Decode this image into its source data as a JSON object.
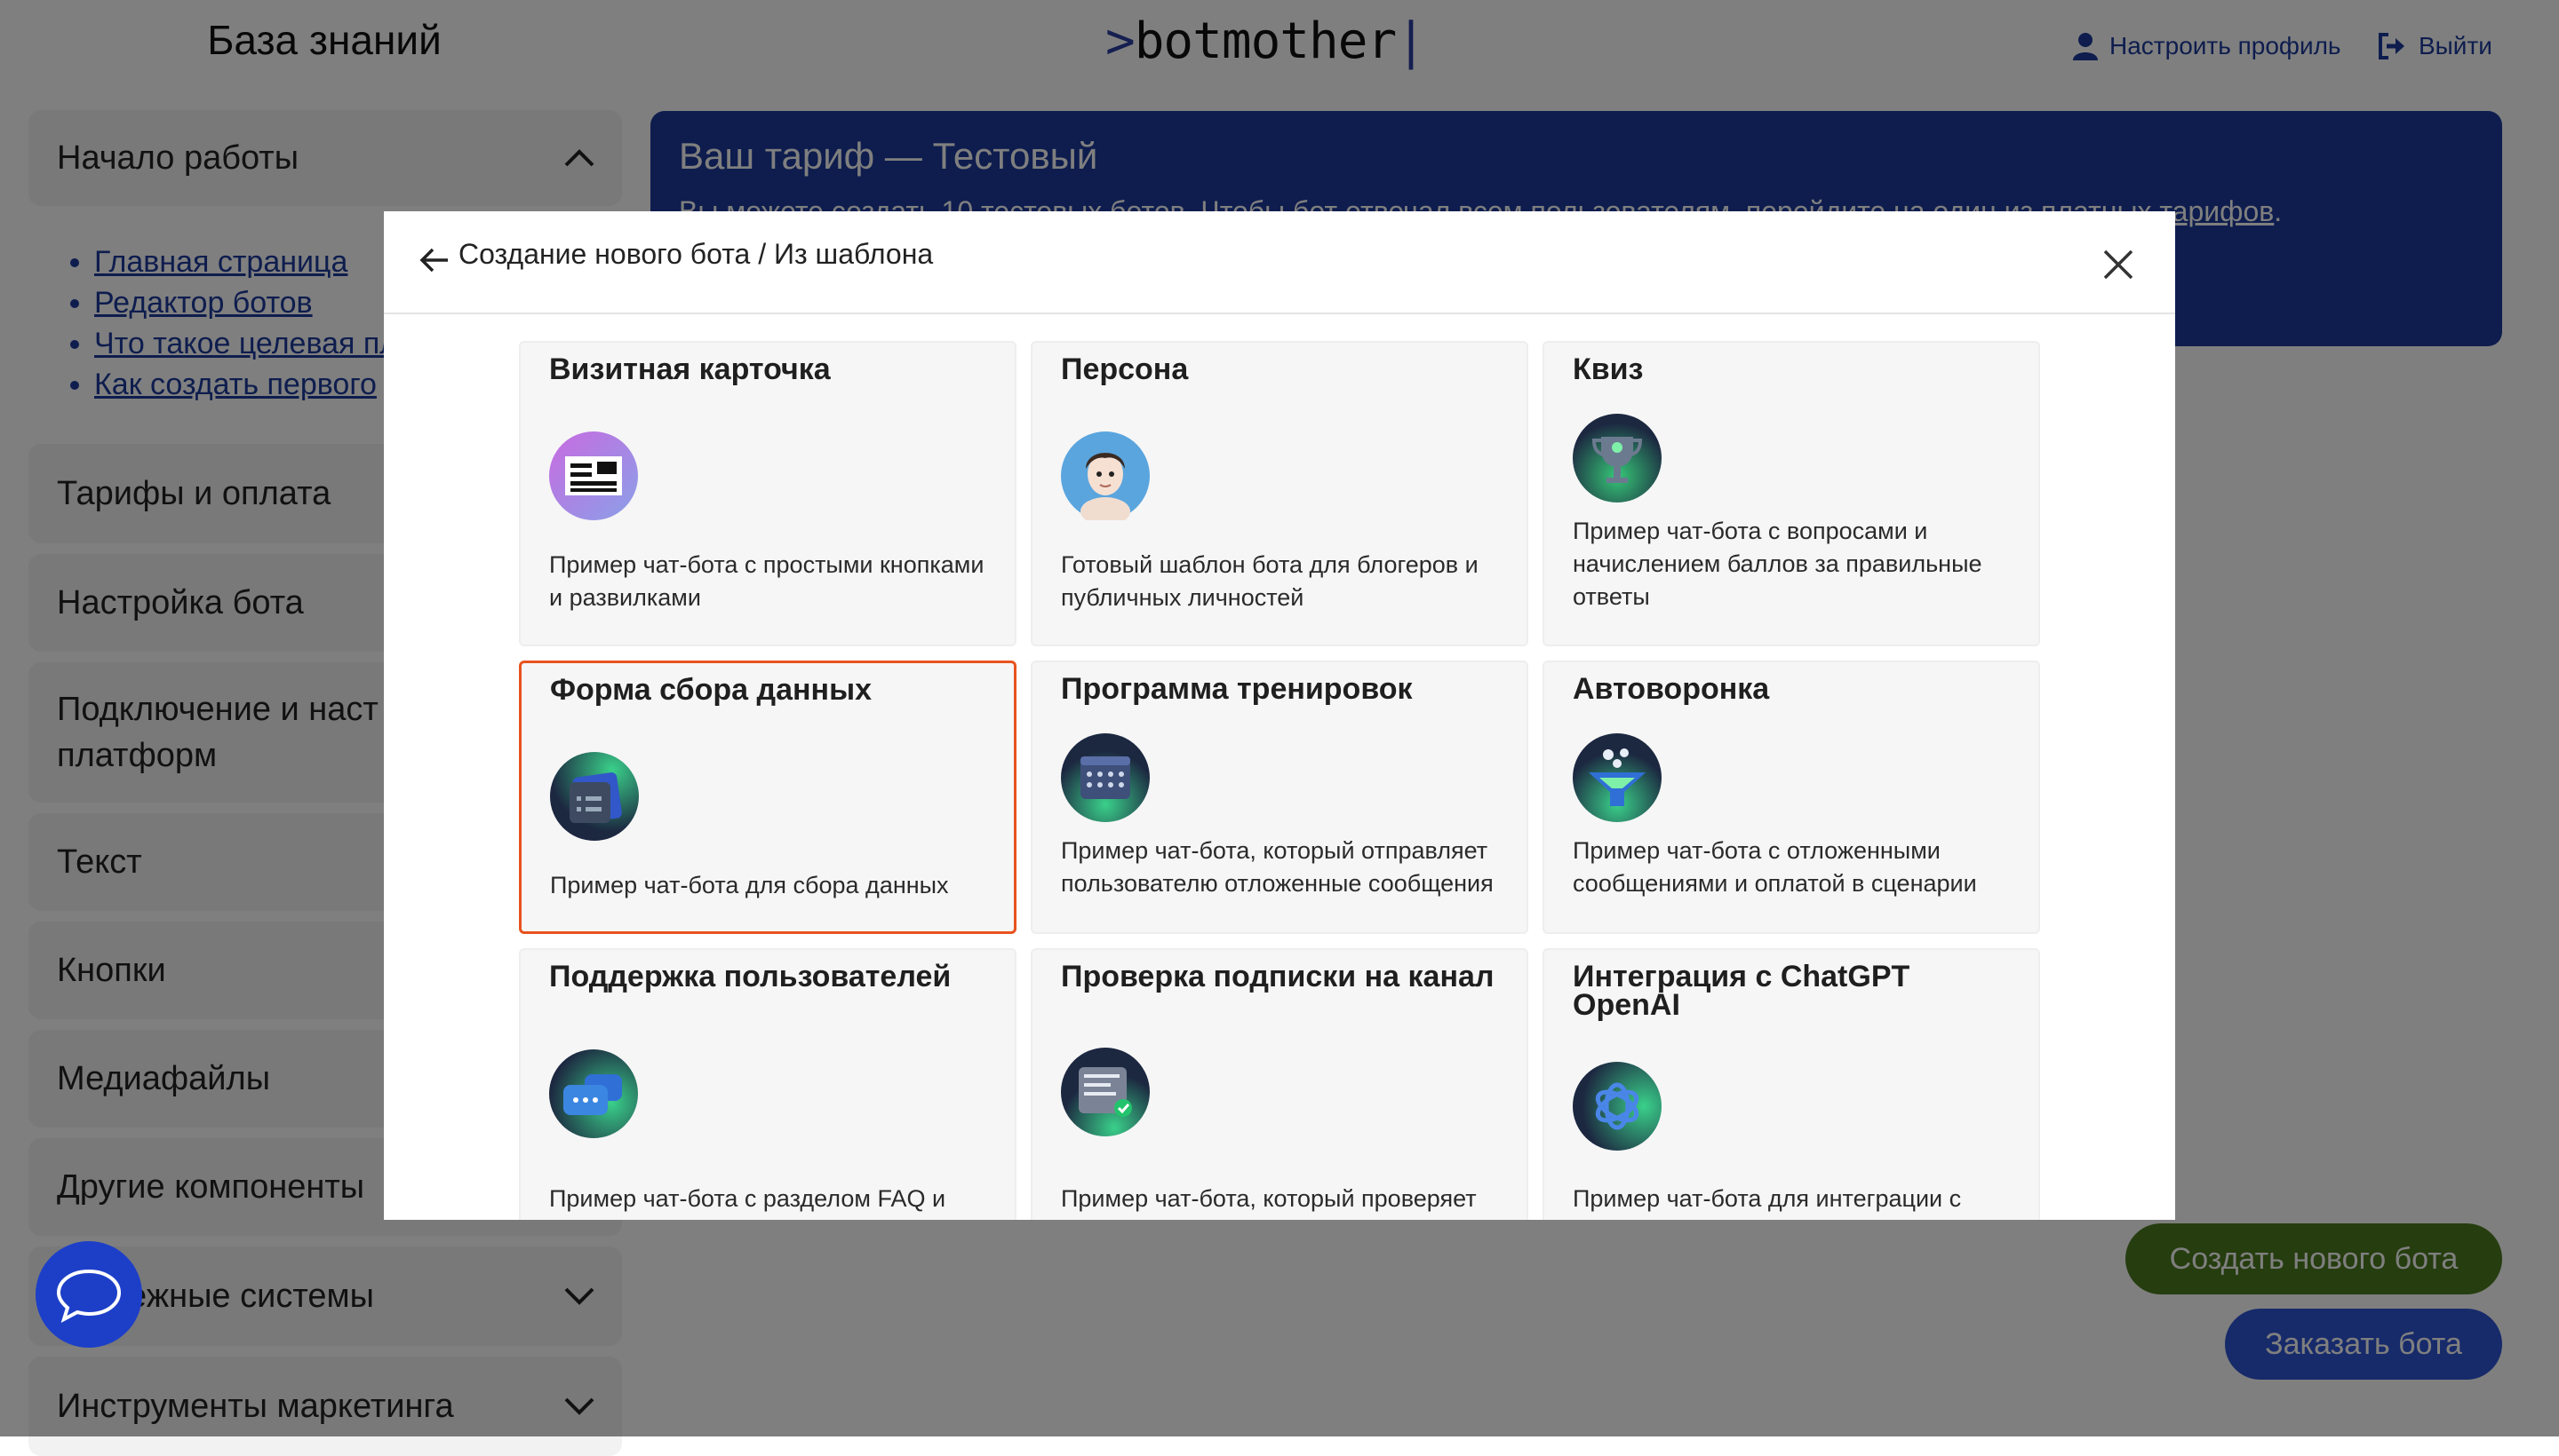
{
  "header": {
    "kb_title": "База знаний",
    "logo_gt": ">",
    "logo_text": "botmother",
    "logo_cursor": "|",
    "profile_label": "Настроить профиль",
    "logout_label": "Выйти"
  },
  "sidebar": {
    "sections": [
      {
        "label": "Начало работы",
        "expanded": true
      },
      {
        "label": "Тарифы и оплата"
      },
      {
        "label": "Настройка бота"
      },
      {
        "label": "Подключение и наст",
        "label2": "платформ"
      },
      {
        "label": "Текст"
      },
      {
        "label": "Кнопки"
      },
      {
        "label": "Медиафайлы"
      },
      {
        "label": "Другие компоненты"
      },
      {
        "label": "ежные системы"
      },
      {
        "label": "Инструменты маркетинга"
      }
    ],
    "links": [
      "Главная страница",
      "Редактор ботов",
      "Что такое целевая пл",
      "Как создать первого"
    ]
  },
  "banner": {
    "title": "Ваш тариф — Тестовый",
    "text_start": "Вы можете создать 10 тестовых ботов. Чтобы бот отвечал всем пользователям, перейдите на один из",
    "text_link": "платных тарифов",
    "text_end": "."
  },
  "buttons": {
    "create_bot": "Создать нового бота",
    "order_bot": "Заказать бота"
  },
  "modal": {
    "breadcrumb": "Создание нового бота / Из шаблона",
    "cards": [
      {
        "title": "Визитная карточка",
        "desc": "Пример чат-бота с простыми кнопками и развилками",
        "icon": "business-card-icon"
      },
      {
        "title": "Персона",
        "desc": "Готовый шаблон бота для блогеров и публичных личностей",
        "icon": "persona-avatar-icon"
      },
      {
        "title": "Квиз",
        "desc": "Пример чат-бота с вопросами и начислением баллов за правильные ответы",
        "icon": "trophy-icon"
      },
      {
        "title": "Форма сбора данных",
        "desc": "Пример чат-бота для сбора данных",
        "icon": "form-icon",
        "selected": true
      },
      {
        "title": "Программа тренировок",
        "desc": "Пример чат-бота, который отправляет пользователю отложенные сообщения",
        "icon": "calendar-icon"
      },
      {
        "title": "Автоворонка",
        "desc": "Пример чат-бота с отложенными сообщениями и оплатой в сценарии",
        "icon": "funnel-icon"
      },
      {
        "title": "Поддержка пользователей",
        "desc": "Пример чат-бота с разделом FAQ и",
        "icon": "support-chat-icon"
      },
      {
        "title": "Проверка подписки на канал",
        "desc": "Пример чат-бота, который проверяет подписку пользователя на канал в",
        "icon": "subscription-check-icon"
      },
      {
        "title": "Интеграция с ChatGPT OpenAI",
        "desc": "Пример чат-бота для интеграции с",
        "icon": "openai-icon"
      }
    ]
  },
  "colors": {
    "brand_blue": "#1d3a9c",
    "selected_border": "#e8531f",
    "create_button": "#4a7a1e",
    "order_button": "#2f55d4"
  }
}
